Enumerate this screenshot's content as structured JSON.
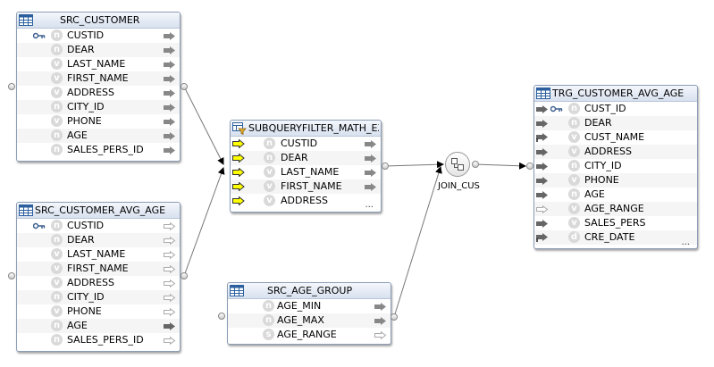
{
  "nodes": {
    "src_customer": {
      "title": "SRC_CUSTOMER",
      "columns": [
        {
          "name": "CUSTID",
          "badge": "n",
          "key": true
        },
        {
          "name": "DEAR",
          "badge": "n"
        },
        {
          "name": "LAST_NAME",
          "badge": "v"
        },
        {
          "name": "FIRST_NAME",
          "badge": "v"
        },
        {
          "name": "ADDRESS",
          "badge": "v"
        },
        {
          "name": "CITY_ID",
          "badge": "n"
        },
        {
          "name": "PHONE",
          "badge": "v"
        },
        {
          "name": "AGE",
          "badge": "n"
        },
        {
          "name": "SALES_PERS_ID",
          "badge": "n"
        }
      ]
    },
    "src_customer_avg_age": {
      "title": "SRC_CUSTOMER_AVG_AGE",
      "columns": [
        {
          "name": "CUSTID",
          "badge": "n",
          "key": true
        },
        {
          "name": "DEAR",
          "badge": "n"
        },
        {
          "name": "LAST_NAME",
          "badge": "v"
        },
        {
          "name": "FIRST_NAME",
          "badge": "v"
        },
        {
          "name": "ADDRESS",
          "badge": "v"
        },
        {
          "name": "CITY_ID",
          "badge": "n"
        },
        {
          "name": "PHONE",
          "badge": "v"
        },
        {
          "name": "AGE",
          "badge": "n"
        },
        {
          "name": "SALES_PERS_ID",
          "badge": "n"
        }
      ]
    },
    "subquery_filter": {
      "title": "SUBQUERYFILTER_MATH_EX",
      "columns": [
        {
          "name": "CUSTID",
          "badge": "n"
        },
        {
          "name": "DEAR",
          "badge": "n"
        },
        {
          "name": "LAST_NAME",
          "badge": "v"
        },
        {
          "name": "FIRST_NAME",
          "badge": "v"
        },
        {
          "name": "ADDRESS",
          "badge": "v"
        }
      ],
      "more": "..."
    },
    "src_age_group": {
      "title": "SRC_AGE_GROUP",
      "columns": [
        {
          "name": "AGE_MIN",
          "badge": "n"
        },
        {
          "name": "AGE_MAX",
          "badge": "n"
        },
        {
          "name": "AGE_RANGE",
          "badge": "s"
        }
      ]
    },
    "join": {
      "label": "JOIN_CUS"
    },
    "trg_customer_avg_age": {
      "title": "TRG_CUSTOMER_AVG_AGE",
      "columns": [
        {
          "name": "CUST_ID",
          "badge": "n",
          "key": true
        },
        {
          "name": "DEAR",
          "badge": "n"
        },
        {
          "name": "CUST_NAME",
          "badge": "v"
        },
        {
          "name": "ADDRESS",
          "badge": "v"
        },
        {
          "name": "CITY_ID",
          "badge": "n"
        },
        {
          "name": "PHONE",
          "badge": "v"
        },
        {
          "name": "AGE",
          "badge": "n"
        },
        {
          "name": "AGE_RANGE",
          "badge": "v"
        },
        {
          "name": "SALES_PERS",
          "badge": "v"
        },
        {
          "name": "CRE_DATE",
          "badge": "d"
        }
      ],
      "more": "..."
    }
  }
}
